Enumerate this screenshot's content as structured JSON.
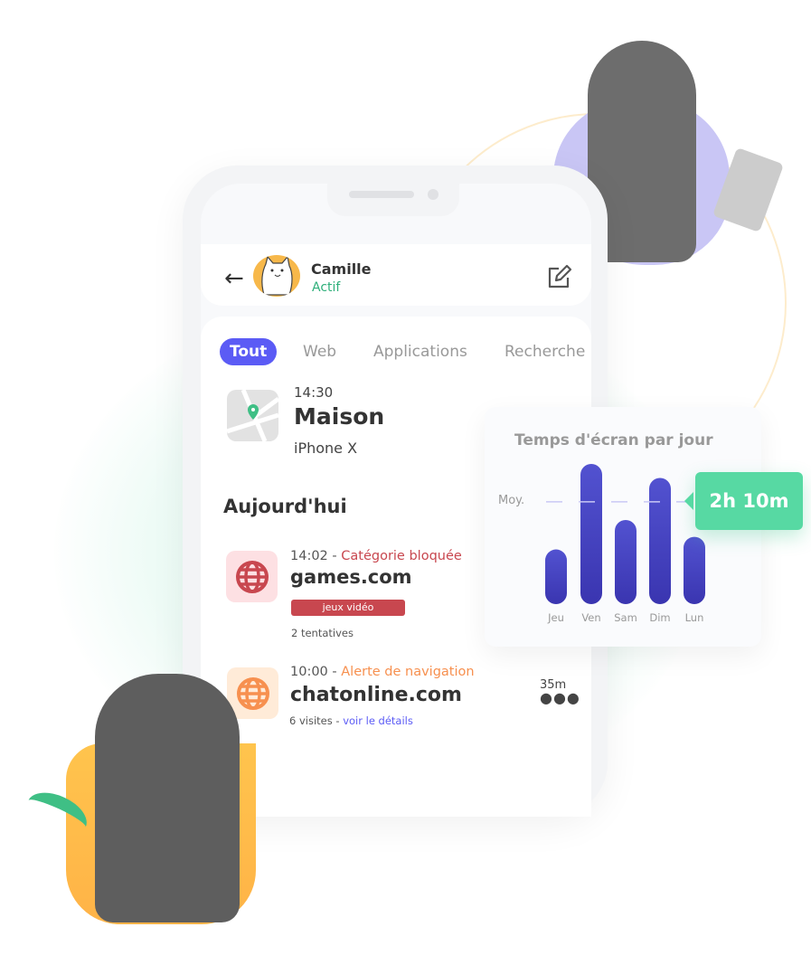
{
  "header": {
    "name": "Camille",
    "status": "Actif",
    "back_icon": "arrow-left-icon",
    "edit_icon": "edit-icon"
  },
  "tabs": [
    {
      "label": "Tout",
      "active": true
    },
    {
      "label": "Web"
    },
    {
      "label": "Applications"
    },
    {
      "label": "Recherche"
    }
  ],
  "location": {
    "time": "14:30",
    "place": "Maison",
    "device": "iPhone X",
    "icon": "map-pin-icon"
  },
  "section_title": "Aujourd'hui",
  "activities": [
    {
      "time": "14:02",
      "separator": " - ",
      "type": "Catégorie bloquée",
      "site": "games.com",
      "badge": "jeux vidéo",
      "detail": "2 tentatives",
      "color": "#c8474f",
      "icon": "globe-icon"
    },
    {
      "time": "10:00",
      "separator": " - ",
      "type": "Alerte de navigation",
      "site": "chatonline.com",
      "detail": "6 visites - ",
      "link": "voir le détails",
      "duration": "35m",
      "color": "#f7904f",
      "icon": "globe-icon"
    }
  ],
  "colors": {
    "accent": "#5b5bf5",
    "green": "#57d9a3",
    "bar": "#4b4bc8"
  },
  "chart_data": {
    "type": "bar",
    "title": "Temps d'écran par jour",
    "categories": [
      "Jeu",
      "Ven",
      "Sam",
      "Dim",
      "Lun"
    ],
    "values": [
      39,
      100,
      60,
      90,
      48
    ],
    "average_label": "Moy.",
    "average_value": 73,
    "average_text": "2h 10m",
    "grid": false
  }
}
